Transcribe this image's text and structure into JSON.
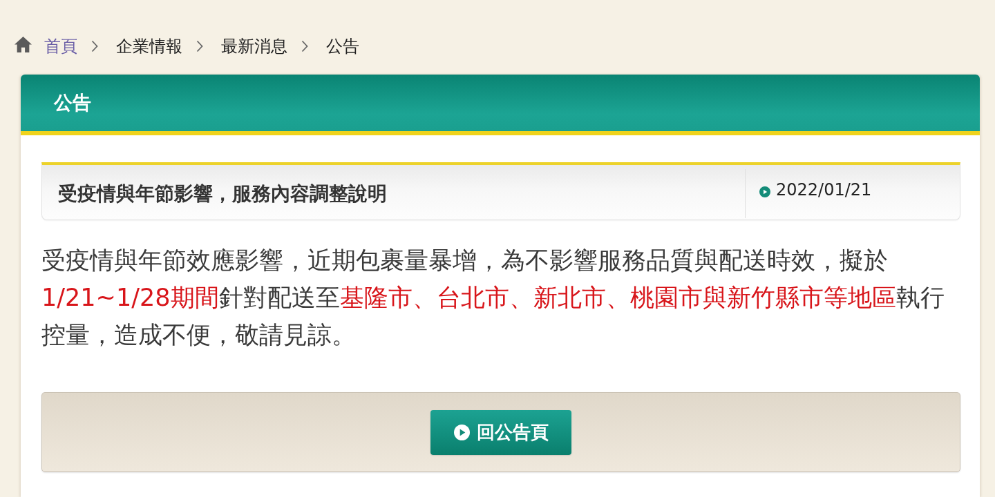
{
  "breadcrumb": [
    {
      "label": "首頁",
      "kind": "link"
    },
    {
      "label": "企業情報",
      "kind": "text"
    },
    {
      "label": "最新消息",
      "kind": "text"
    },
    {
      "label": "公告",
      "kind": "text"
    }
  ],
  "panel": {
    "title": "公告"
  },
  "notice": {
    "title": "受疫情與年節影響，服務內容調整說明",
    "date": "2022/01/21"
  },
  "body": [
    {
      "text": "受疫情與年節效應影響，近期包裹量暴增，為不影響服務品質與配送時效，擬於",
      "highlight": false
    },
    {
      "text": "1/21~1/28期間",
      "highlight": true
    },
    {
      "text": "針對配送至",
      "highlight": false
    },
    {
      "text": "基隆市、台北市、新北市、桃園市與新竹縣市等地區",
      "highlight": true
    },
    {
      "text": "執行控量，造成不便，敬請見諒。",
      "highlight": false
    }
  ],
  "back_button": {
    "label": "回公告頁"
  }
}
